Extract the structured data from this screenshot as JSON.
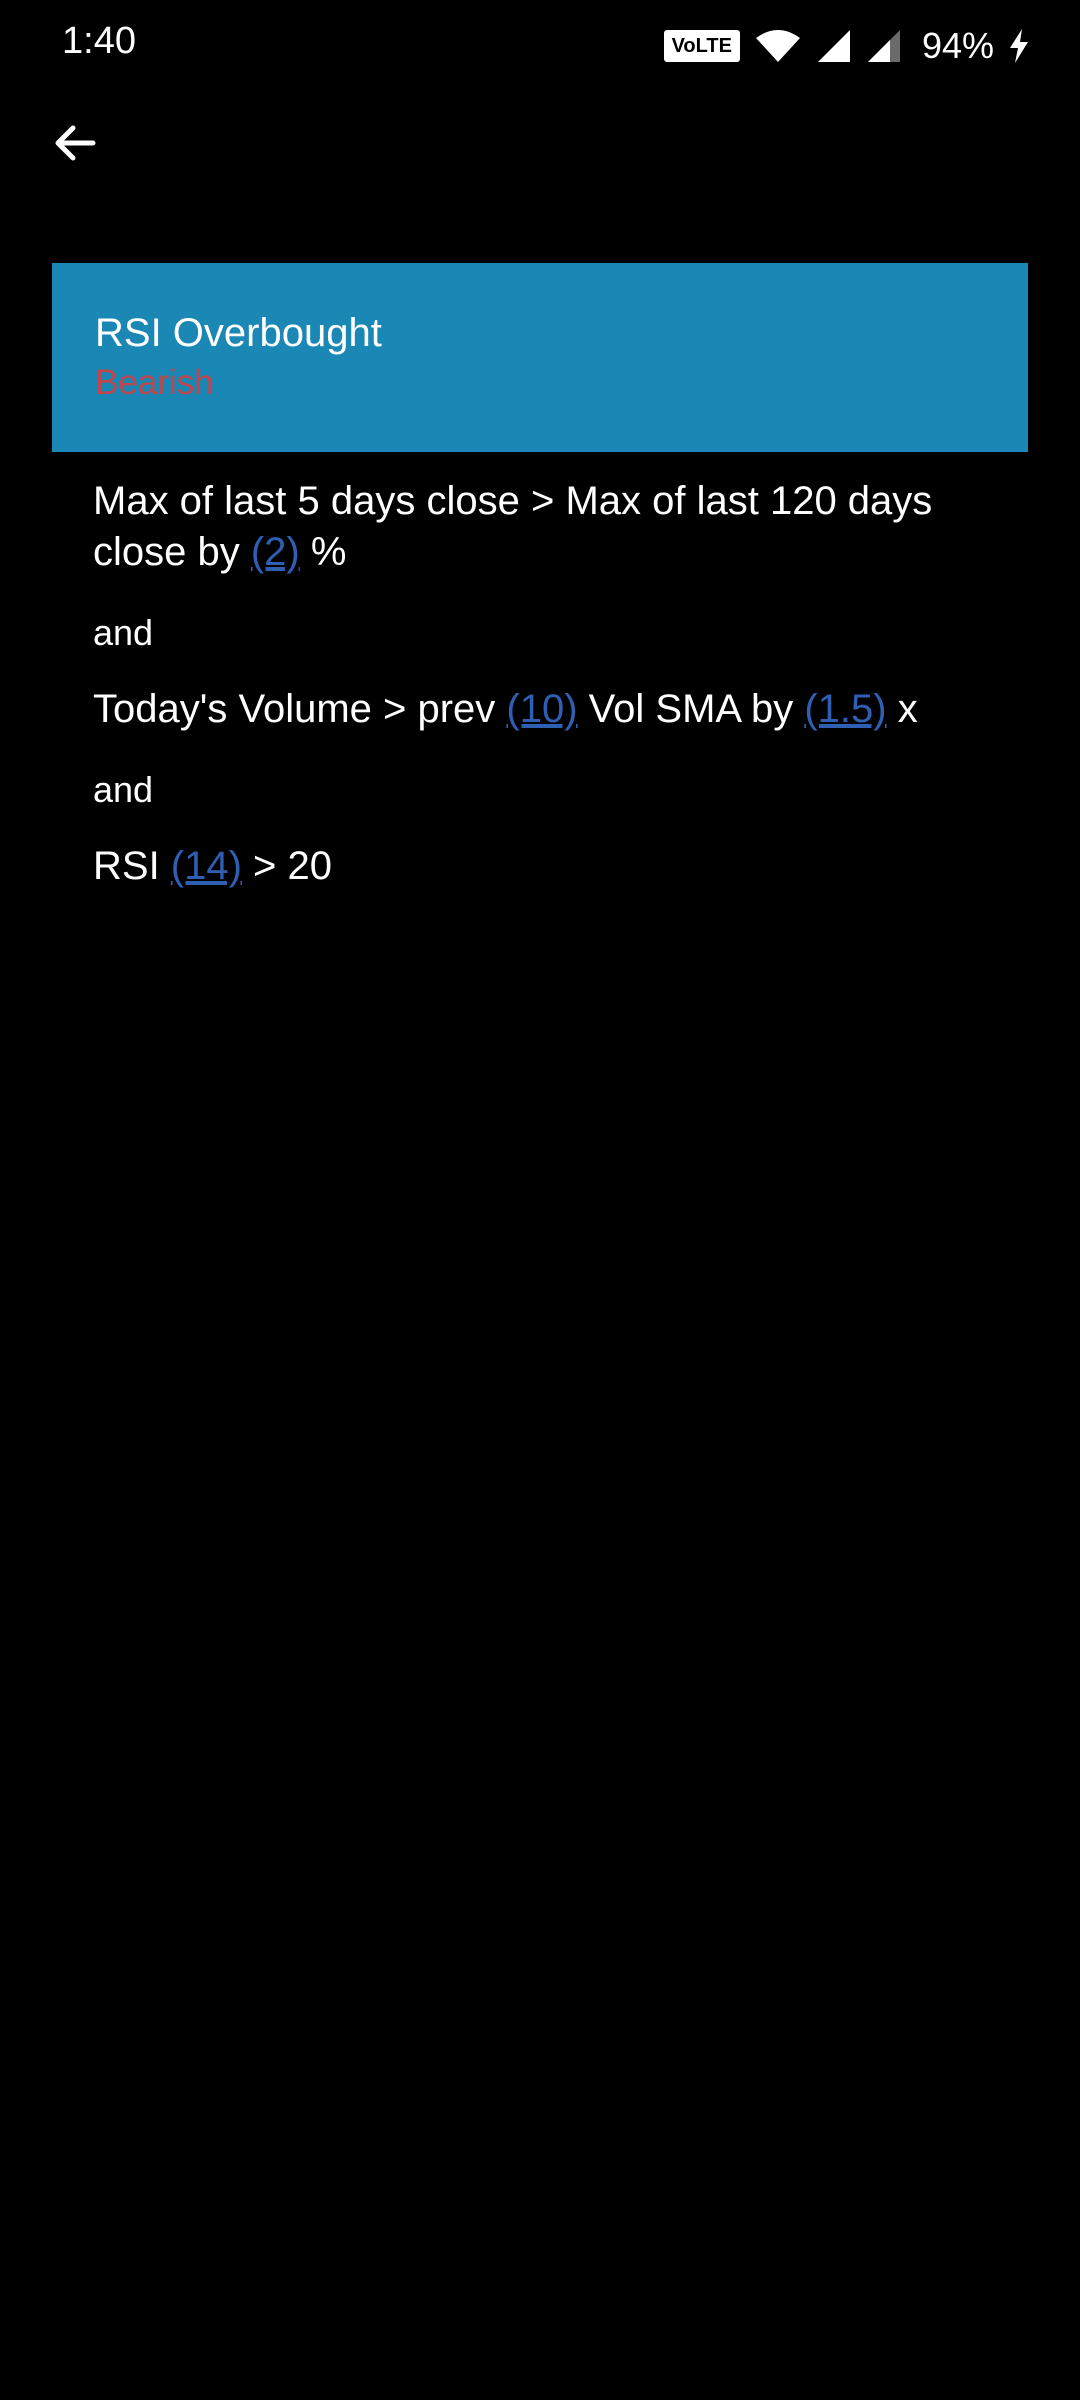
{
  "status_bar": {
    "time": "1:40",
    "volte": "VoLTE",
    "battery": "94%",
    "icons": [
      "wifi-icon",
      "signal-icon",
      "signal-icon",
      "charging-icon"
    ]
  },
  "nav": {
    "back_icon": "arrow-left-icon"
  },
  "card": {
    "title": "RSI Overbought",
    "subtitle": "Bearish",
    "background_color": "#1a87b4",
    "subtitle_color": "#c0474d"
  },
  "conditions": {
    "c1": {
      "pre": "Max of last 5 days close > Max of last 120 days close by ",
      "p1": "(2)",
      "post": " %"
    },
    "and1": "and",
    "c2": {
      "pre": "Today's Volume > prev ",
      "p1": "(10)",
      "mid": " Vol SMA by ",
      "p2": "(1.5)",
      "post": " x"
    },
    "and2": "and",
    "c3": {
      "pre": "RSI ",
      "p1": "(14)",
      "post": " > 20"
    },
    "param_color": "#2f5fb3"
  }
}
